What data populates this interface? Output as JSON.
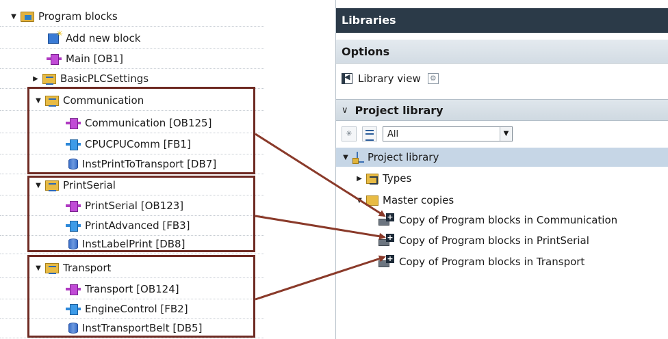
{
  "tree": {
    "program_blocks": "Program blocks",
    "add_new_block": "Add new block",
    "main": "Main [OB1]",
    "basic_plc": "BasicPLCSettings",
    "communication": {
      "folder": "Communication",
      "items": [
        "Communication [OB125]",
        "CPUCPUComm [FB1]",
        "InstPrintToTransport [DB7]"
      ]
    },
    "printserial": {
      "folder": "PrintSerial",
      "items": [
        "PrintSerial [OB123]",
        "PrintAdvanced [FB3]",
        "InstLabelPrint [DB8]"
      ]
    },
    "transport": {
      "folder": "Transport",
      "items": [
        "Transport [OB124]",
        "EngineControl [FB2]",
        "InstTransportBelt [DB5]"
      ]
    }
  },
  "libraries": {
    "title": "Libraries",
    "options": "Options",
    "library_view": "Library view",
    "project_library_header": "Project library",
    "filter_value": "All",
    "tree": {
      "root": "Project library",
      "types": "Types",
      "master_copies": "Master copies",
      "copies": [
        "Copy of Program blocks in Communication",
        "Copy of Program blocks in PrintSerial",
        "Copy of Program blocks in Transport"
      ]
    }
  },
  "colors": {
    "highlight_box": "#6e2a22",
    "arrow": "#8a3a2a",
    "header_dark": "#2b3a48",
    "selected_row": "#c6d6e6"
  },
  "icons": [
    "expand-arrow-icon",
    "collapse-arrow-icon",
    "program-blocks-icon",
    "add-block-icon",
    "ob-block-icon",
    "fb-block-icon",
    "db-block-icon",
    "group-folder-icon",
    "library-view-icon",
    "project-library-icon",
    "types-folder-icon",
    "master-copies-folder-icon",
    "master-copy-icon"
  ]
}
